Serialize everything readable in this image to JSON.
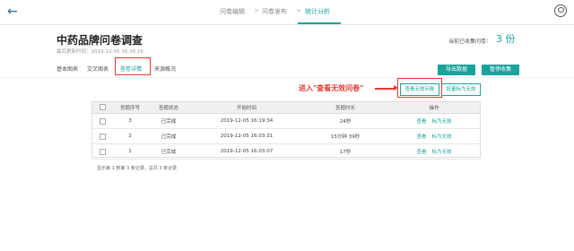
{
  "nav": {
    "steps": [
      "问卷编辑",
      "问卷发布",
      "统计分析"
    ],
    "separator": ">"
  },
  "survey": {
    "title": "中药品牌问卷调查",
    "updated": "最后更新时间：2019-12-05 16:36:16",
    "count_label": "当前已收集问卷：",
    "count": "3 份"
  },
  "tabs": [
    "基本图表",
    "交叉图表",
    "答卷详情",
    "来源概况"
  ],
  "buttons": {
    "export": "导出数据",
    "pause": "暂停收集",
    "view_invalid": "查看无效问卷",
    "batch_invalid": "批量标为无效"
  },
  "annotation": "进入\"查看无效问卷\"",
  "table": {
    "headers": [
      "答题序号",
      "答题状态",
      "开始时间",
      "答题时长",
      "操作"
    ],
    "rows": [
      {
        "no": "3",
        "status": "已完成",
        "start": "2019-12-05 16:19:34",
        "duration": "24秒"
      },
      {
        "no": "2",
        "status": "已完成",
        "start": "2019-12-05 16:03:31",
        "duration": "15分钟 39秒"
      },
      {
        "no": "1",
        "status": "已完成",
        "start": "2019-12-05 16:03:07",
        "duration": "17秒"
      }
    ],
    "action_view": "查看",
    "action_invalid": "标为无效"
  },
  "footer": "显示第 1 到第 3 条记录，总共 3 条记录"
}
